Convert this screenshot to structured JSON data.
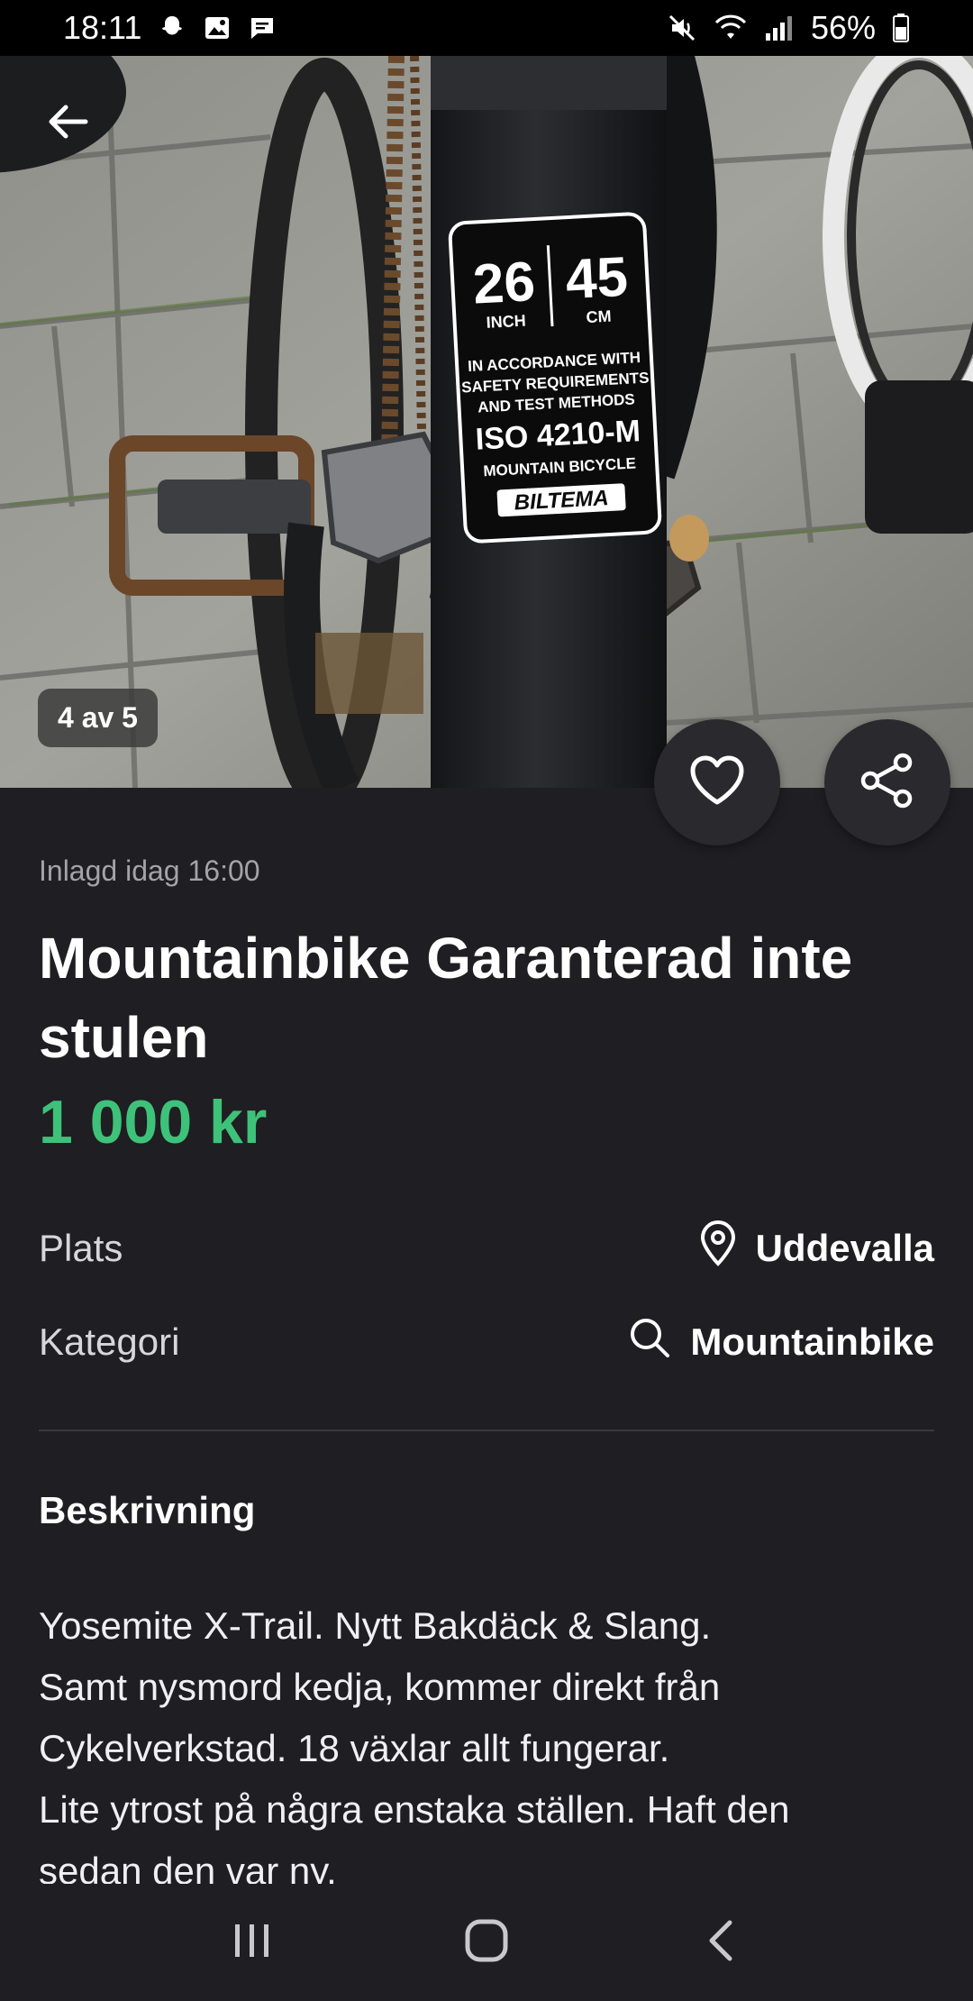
{
  "status_bar": {
    "time": "18:11",
    "battery": "56%",
    "icons_left": [
      "snapchat-icon",
      "image-icon",
      "message-icon"
    ],
    "icons_right": [
      "mute-icon",
      "wifi-icon",
      "signal-icon",
      "battery-icon"
    ]
  },
  "hero": {
    "photo_counter": "4 av 5",
    "label_inch": "26",
    "label_inch_unit": "INCH",
    "label_cm": "45",
    "label_cm_unit": "CM",
    "label_lines": [
      "IN ACCORDANCE WITH",
      "SAFETY REQUIREMENTS",
      "AND TEST METHODS"
    ],
    "label_iso": "ISO 4210-M",
    "label_type": "MOUNTAIN BICYCLE",
    "label_brand": "BILTEMA"
  },
  "listing": {
    "posted": "Inlagd idag 16:00",
    "title": "Mountainbike Garanterad inte stulen",
    "price": "1 000 kr"
  },
  "info": {
    "location_label": "Plats",
    "location_value": "Uddevalla",
    "category_label": "Kategori",
    "category_value": "Mountainbike"
  },
  "description": {
    "heading": "Beskrivning",
    "lines": [
      "Yosemite X-Trail. Nytt Bakdäck & Slang.",
      "Samt nysmord kedja, kommer direkt från",
      "Cykelverkstad. 18 växlar allt fungerar.",
      "Lite ytrost på några enstaka ställen. Haft den",
      "sedan den var ny."
    ]
  },
  "colors": {
    "background": "#1f1e22",
    "price": "#3ec27a",
    "muted_text": "#a4a3a8"
  }
}
